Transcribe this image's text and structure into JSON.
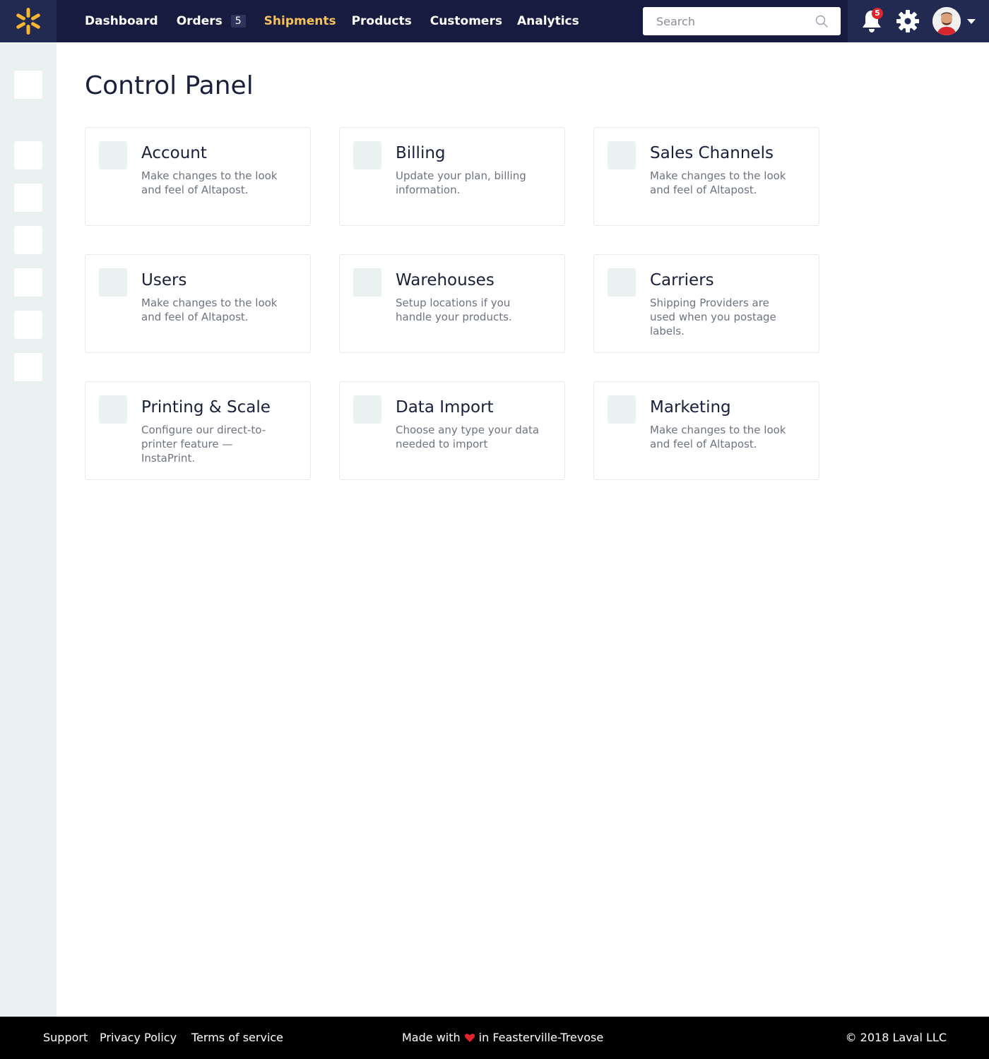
{
  "colors": {
    "topbar": "#161b3f",
    "topbar_accent": "#232a52",
    "brand": "#f5b731",
    "active_nav": "#f5c15a",
    "sidebar": "#e9f1f1",
    "notification": "#e0242c",
    "footer": "#000000"
  },
  "header": {
    "logo_icon": "asterisk-logo-icon",
    "nav": [
      {
        "label": "Dashboard"
      },
      {
        "label": "Orders",
        "badge": "5"
      },
      {
        "label": "Shipments",
        "active": true
      },
      {
        "label": "Products"
      },
      {
        "label": "Customers"
      },
      {
        "label": "Analytics"
      }
    ],
    "search": {
      "placeholder": "Search",
      "value": ""
    },
    "notifications": {
      "count": "5",
      "icon": "bell-icon"
    },
    "settings_icon": "gear-icon",
    "avatar_icon": "user-avatar",
    "menu_icon": "caret-down-icon"
  },
  "sidebar": {
    "items": 7
  },
  "main": {
    "title": "Control Panel",
    "cards": [
      {
        "title": "Account",
        "description": "Make changes to the look and feel of Altapost."
      },
      {
        "title": "Billing",
        "description": "Update your plan, billing information."
      },
      {
        "title": "Sales Channels",
        "description": "Make changes to the look and feel of Altapost."
      },
      {
        "title": "Users",
        "description": "Make changes to the look and feel of Altapost."
      },
      {
        "title": "Warehouses",
        "description": "Setup locations if you handle your products."
      },
      {
        "title": "Carriers",
        "description": "Shipping Providers are used when you postage labels."
      },
      {
        "title": "Printing & Scale",
        "description": "Configure our direct-to-printer feature — InstaPrint."
      },
      {
        "title": "Data Import",
        "description": "Choose any type your data needed to import"
      },
      {
        "title": "Marketing",
        "description": "Make changes to the look and feel of Altapost."
      }
    ]
  },
  "footer": {
    "links": [
      "Support",
      "Privacy Policy",
      "Terms of service"
    ],
    "made_prefix": "Made with",
    "made_suffix": "in Feasterville-Trevose",
    "copyright": "© 2018 Laval LLC"
  }
}
